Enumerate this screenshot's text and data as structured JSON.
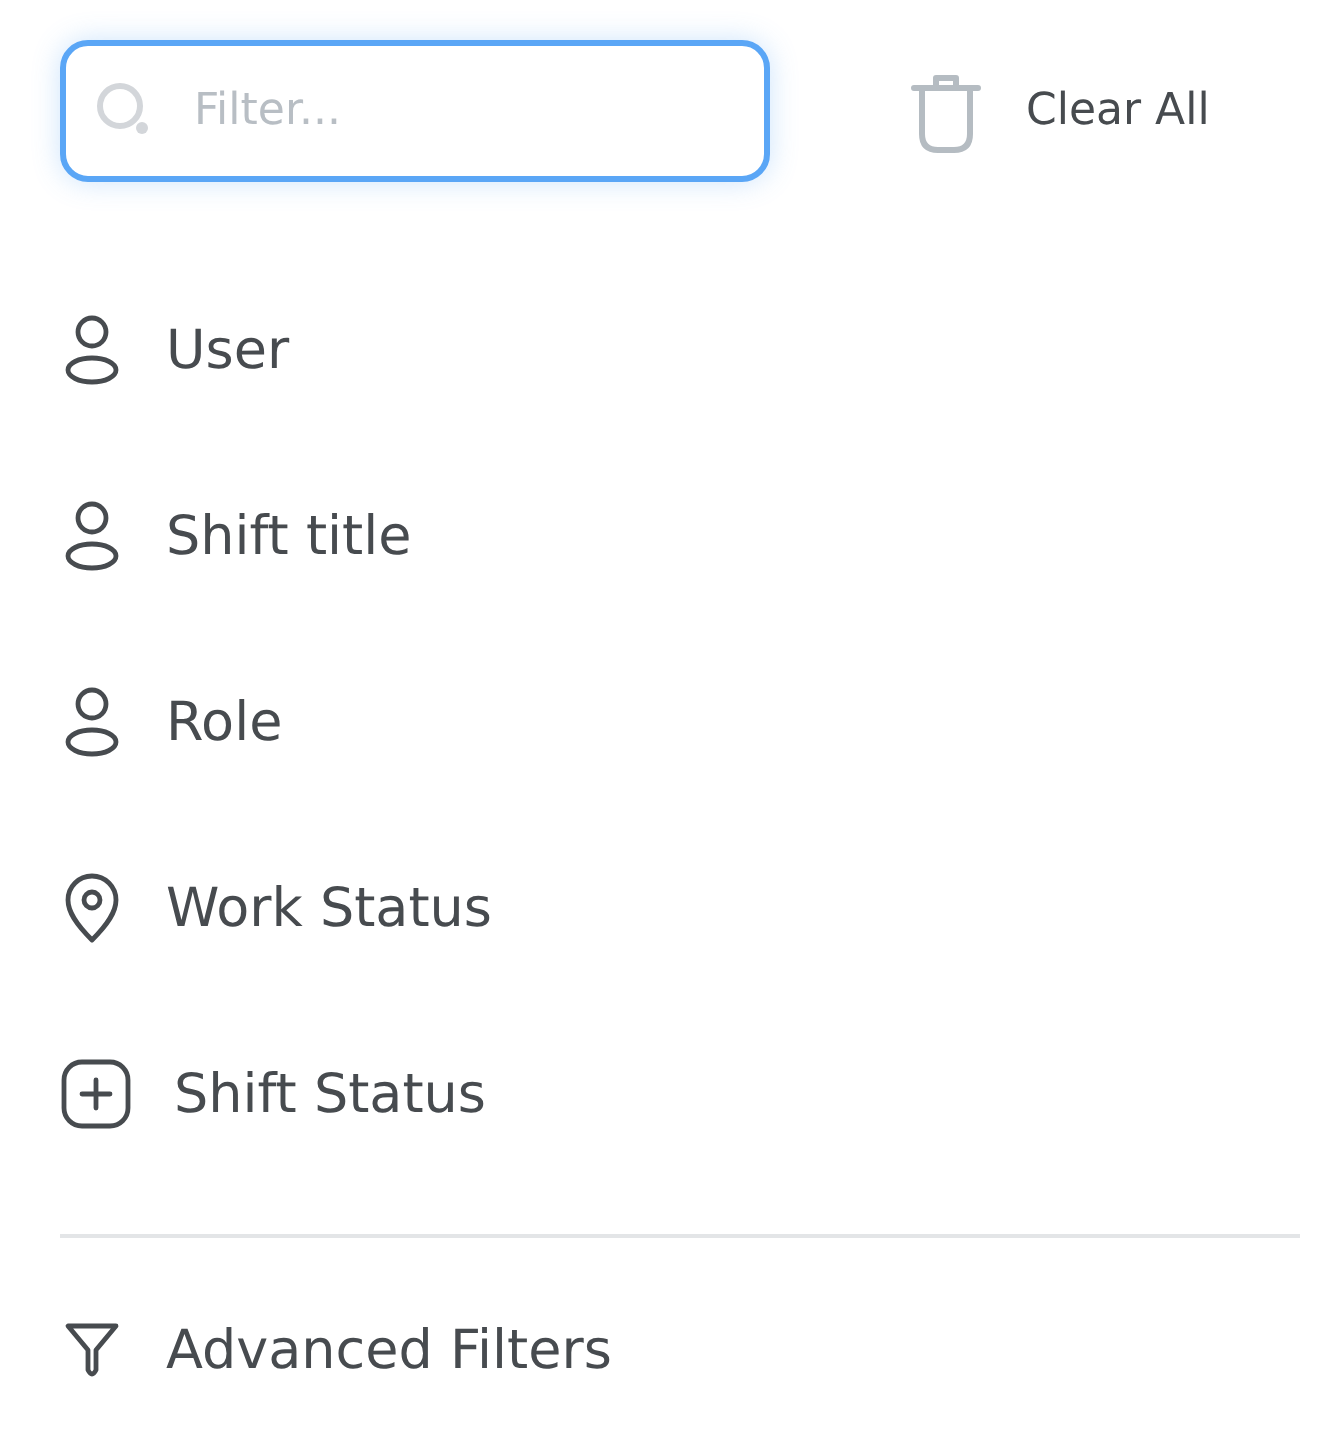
{
  "search": {
    "placeholder": "Filter...",
    "focused": true
  },
  "clear_button": {
    "label": "Clear All"
  },
  "items": [
    {
      "kind": "person",
      "label": "User"
    },
    {
      "kind": "person",
      "label": "Shift title"
    },
    {
      "kind": "person",
      "label": "Role"
    },
    {
      "kind": "pin",
      "label": "Work Status"
    },
    {
      "kind": "plus",
      "label": "Shift Status"
    }
  ],
  "advanced": {
    "label": "Advanced Filters"
  }
}
